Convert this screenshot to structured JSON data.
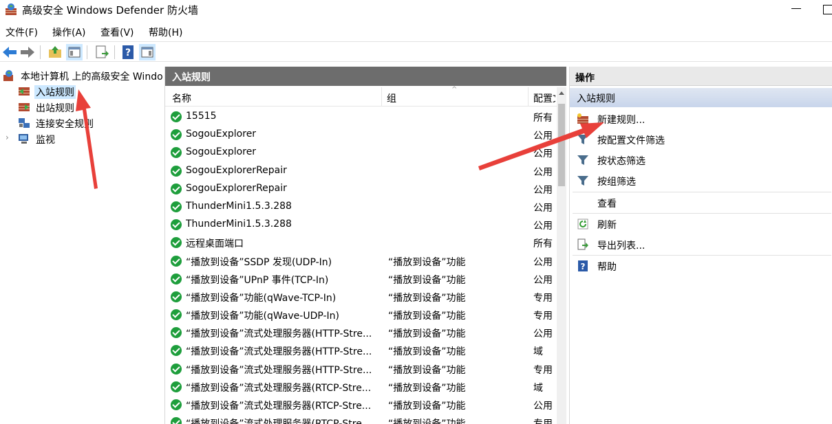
{
  "window": {
    "title": "高级安全 Windows Defender 防火墙"
  },
  "menu": [
    "文件(F)",
    "操作(A)",
    "查看(V)",
    "帮助(H)"
  ],
  "toolbar": {
    "icons": [
      "back-icon",
      "forward-icon",
      "up-folder-icon",
      "show-tree-icon",
      "export-icon",
      "help-icon",
      "show-action-pane-icon"
    ]
  },
  "tree": {
    "root": "本地计算机 上的高级安全 Windows Defender 防火墙",
    "items": [
      "入站规则",
      "出站规则",
      "连接安全规则",
      "监视"
    ],
    "selected": "入站规则"
  },
  "center": {
    "header": "入站规则",
    "columns": [
      "名称",
      "组",
      "配置文件"
    ],
    "rows": [
      {
        "name": "15515",
        "group": "",
        "profile": "所有"
      },
      {
        "name": "SogouExplorer",
        "group": "",
        "profile": "公用"
      },
      {
        "name": "SogouExplorer",
        "group": "",
        "profile": "公用"
      },
      {
        "name": "SogouExplorerRepair",
        "group": "",
        "profile": "公用"
      },
      {
        "name": "SogouExplorerRepair",
        "group": "",
        "profile": "公用"
      },
      {
        "name": "ThunderMini1.5.3.288",
        "group": "",
        "profile": "公用"
      },
      {
        "name": "ThunderMini1.5.3.288",
        "group": "",
        "profile": "公用"
      },
      {
        "name": "远程桌面端口",
        "group": "",
        "profile": "所有"
      },
      {
        "name": "“播放到设备”SSDP 发现(UDP-In)",
        "group": "“播放到设备”功能",
        "profile": "公用"
      },
      {
        "name": "“播放到设备”UPnP 事件(TCP-In)",
        "group": "“播放到设备”功能",
        "profile": "公用"
      },
      {
        "name": "“播放到设备”功能(qWave-TCP-In)",
        "group": "“播放到设备”功能",
        "profile": "专用"
      },
      {
        "name": "“播放到设备”功能(qWave-UDP-In)",
        "group": "“播放到设备”功能",
        "profile": "专用"
      },
      {
        "name": "“播放到设备”流式处理服务器(HTTP-Stre...",
        "group": "“播放到设备”功能",
        "profile": "公用"
      },
      {
        "name": "“播放到设备”流式处理服务器(HTTP-Stre...",
        "group": "“播放到设备”功能",
        "profile": "域"
      },
      {
        "name": "“播放到设备”流式处理服务器(HTTP-Stre...",
        "group": "“播放到设备”功能",
        "profile": "专用"
      },
      {
        "name": "“播放到设备”流式处理服务器(RTCP-Stre...",
        "group": "“播放到设备”功能",
        "profile": "域"
      },
      {
        "name": "“播放到设备”流式处理服务器(RTCP-Stre...",
        "group": "“播放到设备”功能",
        "profile": "公用"
      },
      {
        "name": "“播放到设备”流式处理服务器(RTCP-Stre...",
        "group": "“播放到设备”功能",
        "profile": "专用"
      }
    ]
  },
  "actions": {
    "header": "操作",
    "section": "入站规则",
    "items": [
      {
        "label": "新建规则...",
        "icon": "new-rule-icon"
      },
      {
        "label": "按配置文件筛选",
        "icon": "filter-icon"
      },
      {
        "label": "按状态筛选",
        "icon": "filter-icon"
      },
      {
        "label": "按组筛选",
        "icon": "filter-icon"
      },
      {
        "label": "查看",
        "icon": ""
      },
      {
        "label": "刷新",
        "icon": "refresh-icon"
      },
      {
        "label": "导出列表...",
        "icon": "export-list-icon"
      },
      {
        "label": "帮助",
        "icon": "help-icon"
      }
    ]
  },
  "colors": {
    "accent_header": "#6d6d6d",
    "selection": "#cce8ff",
    "annotation_arrow": "#e8403a",
    "check_green": "#1e9e3c"
  }
}
